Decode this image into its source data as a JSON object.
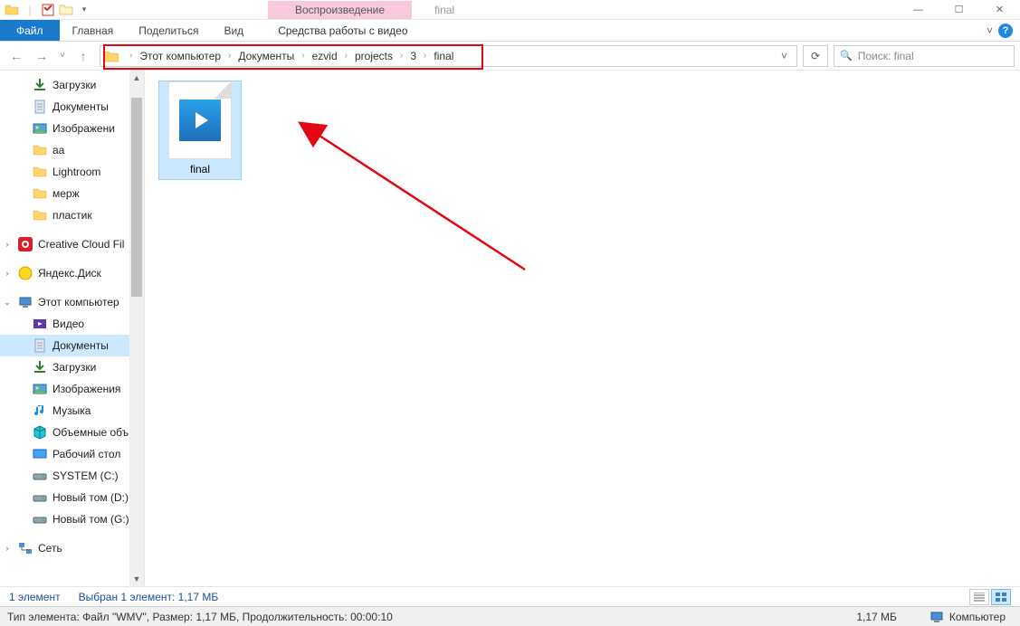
{
  "window": {
    "context_tab": "Воспроизведение",
    "title": "final",
    "min": "—",
    "max": "☐",
    "close": "✕"
  },
  "ribbon": {
    "file": "Файл",
    "tabs": [
      "Главная",
      "Поделиться",
      "Вид"
    ],
    "context_tab": "Средства работы с видео",
    "expand": "˅"
  },
  "address": {
    "back": "←",
    "fwd": "→",
    "up": "↑",
    "drop_hist": "˅",
    "crumbs": [
      "Этот компьютер",
      "Документы",
      "ezvid",
      "projects",
      "3",
      "final"
    ],
    "sep": "›",
    "drop": "˅",
    "refresh": "⟳",
    "search_icon": "🔍",
    "search_placeholder": "Поиск: final"
  },
  "tree": [
    {
      "icon": "download",
      "label": "Загрузки",
      "pinned": true,
      "indent": 1
    },
    {
      "icon": "doc",
      "label": "Документы",
      "pinned": true,
      "indent": 1
    },
    {
      "icon": "img",
      "label": "Изображени",
      "pinned": true,
      "indent": 1
    },
    {
      "icon": "folder",
      "label": "aa",
      "indent": 1
    },
    {
      "icon": "folder",
      "label": "Lightroom",
      "indent": 1
    },
    {
      "icon": "folder",
      "label": "мерж",
      "indent": 1
    },
    {
      "icon": "folder",
      "label": "пластик",
      "indent": 1
    },
    {
      "spacer": true
    },
    {
      "icon": "cc",
      "label": "Creative Cloud Fil",
      "indent": 0,
      "chev": true
    },
    {
      "spacer": true
    },
    {
      "icon": "yd",
      "label": "Яндекс.Диск",
      "indent": 0,
      "chev": true
    },
    {
      "spacer": true
    },
    {
      "icon": "pc",
      "label": "Этот компьютер",
      "indent": 0,
      "chev": "open"
    },
    {
      "icon": "vid",
      "label": "Видео",
      "indent": 1
    },
    {
      "icon": "doc",
      "label": "Документы",
      "indent": 1,
      "selected": true
    },
    {
      "icon": "download",
      "label": "Загрузки",
      "indent": 1
    },
    {
      "icon": "img",
      "label": "Изображения",
      "indent": 1
    },
    {
      "icon": "music",
      "label": "Музыка",
      "indent": 1
    },
    {
      "icon": "cube",
      "label": "Объемные объ",
      "indent": 1
    },
    {
      "icon": "desk",
      "label": "Рабочий стол",
      "indent": 1
    },
    {
      "icon": "drive",
      "label": "SYSTEM (C:)",
      "indent": 1
    },
    {
      "icon": "drive",
      "label": "Новый том (D:)",
      "indent": 1
    },
    {
      "icon": "drive",
      "label": "Новый том (G:)",
      "indent": 1
    },
    {
      "spacer": true
    },
    {
      "icon": "net",
      "label": "Сеть",
      "indent": 0,
      "chev": true
    }
  ],
  "files": [
    {
      "name": "final",
      "selected": true
    }
  ],
  "selstrip": {
    "count": "1 элемент",
    "selection": "Выбран 1 элемент: 1,17 МБ"
  },
  "status": {
    "left": "Тип элемента: Файл \"WMV\", Размер: 1,17 МБ, Продолжительность: 00:00:10",
    "size": "1,17 МБ",
    "location_label": "Компьютер"
  }
}
